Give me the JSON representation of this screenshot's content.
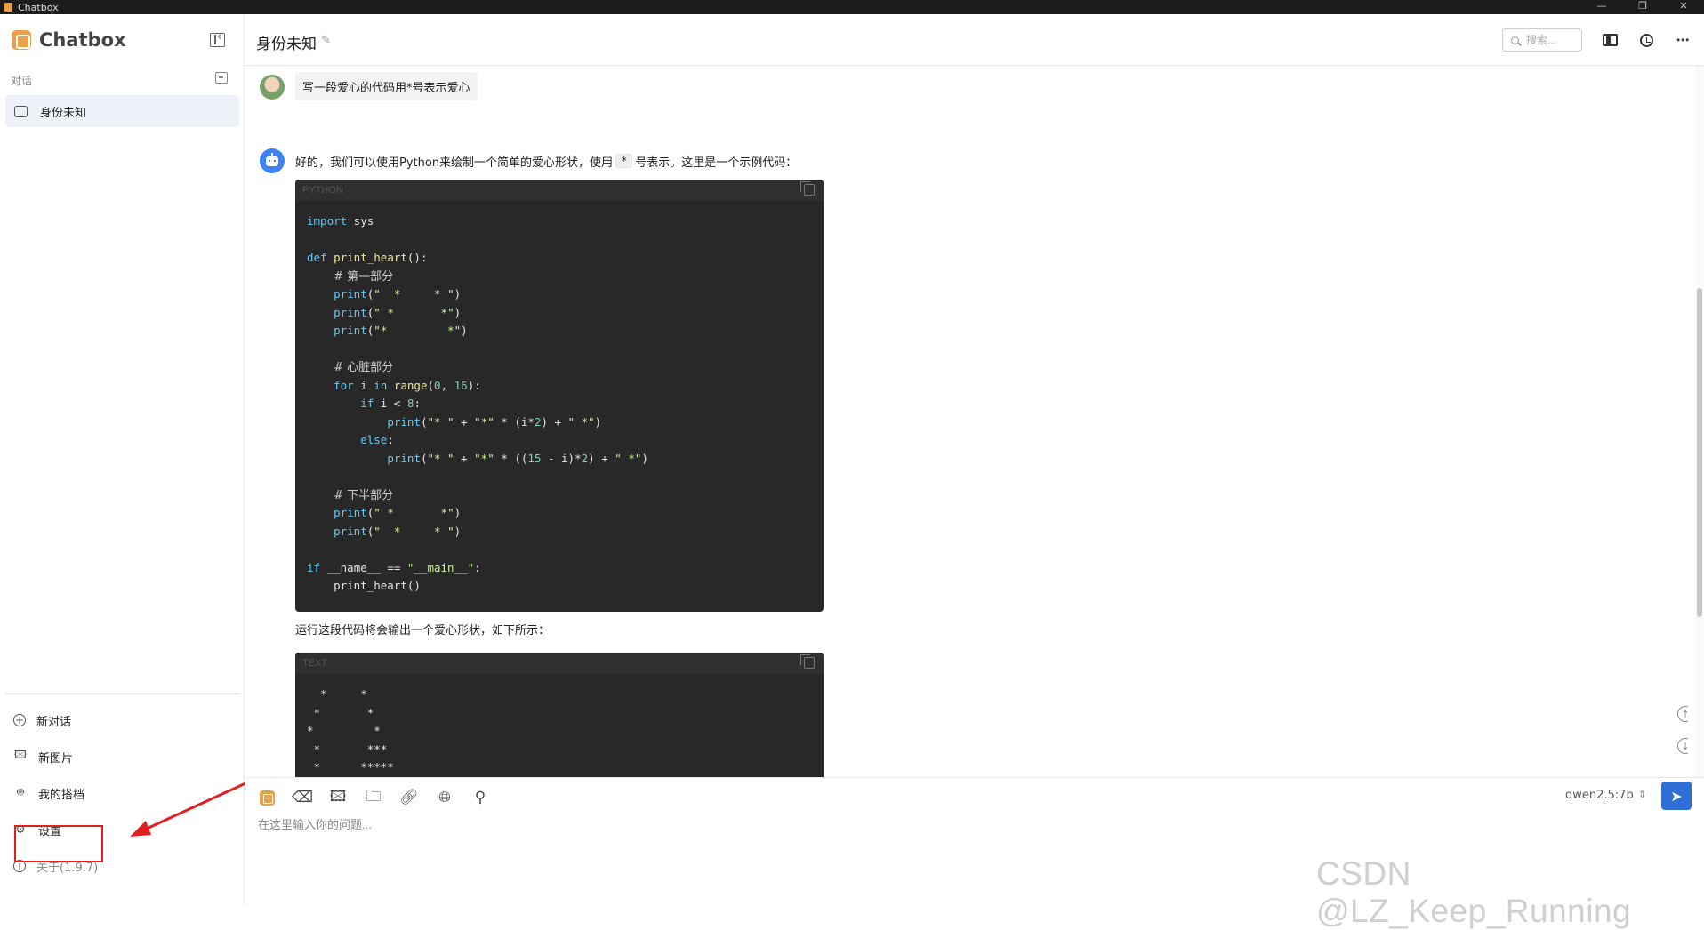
{
  "window": {
    "title": "Chatbox",
    "controls": [
      "—",
      "❐",
      "✕"
    ]
  },
  "sidebar": {
    "brand": "Chatbox",
    "section_label": "对话",
    "conversations": [
      {
        "label": "身份未知"
      }
    ],
    "menu": [
      {
        "label": "新对话",
        "icon": "plus-circle-icon"
      },
      {
        "label": "新图片",
        "icon": "image-icon"
      },
      {
        "label": "我的搭档",
        "icon": "robot-icon"
      },
      {
        "label": "设置",
        "icon": "gear-icon"
      },
      {
        "label": "关于(1.9.7)",
        "icon": "info-icon"
      }
    ]
  },
  "header": {
    "title": "身份未知",
    "search_placeholder": "搜索..."
  },
  "messages": {
    "user_text": "写一段爱心的代码用*号表示爱心",
    "bot_intro_before": "好的，我们可以使用Python来绘制一个简单的爱心形状，使用",
    "bot_intro_code": "*",
    "bot_intro_after": "号表示。这里是一个示例代码：",
    "code_lang": "PYTHON",
    "bot_outro": "运行这段代码将会输出一个爱心形状，如下所示：",
    "text_lang": "TEXT",
    "text_output": [
      "  *     *",
      " *       *",
      "*         *",
      " *       ***",
      " *      *****"
    ]
  },
  "composer": {
    "model": "qwen2.5:7b",
    "placeholder": "在这里输入你的问题..."
  },
  "watermark": "CSDN @LZ_Keep_Running",
  "colors": {
    "accent": "#2f6fd6",
    "brand": "#e8a04a",
    "highlight_box": "#e02020"
  }
}
